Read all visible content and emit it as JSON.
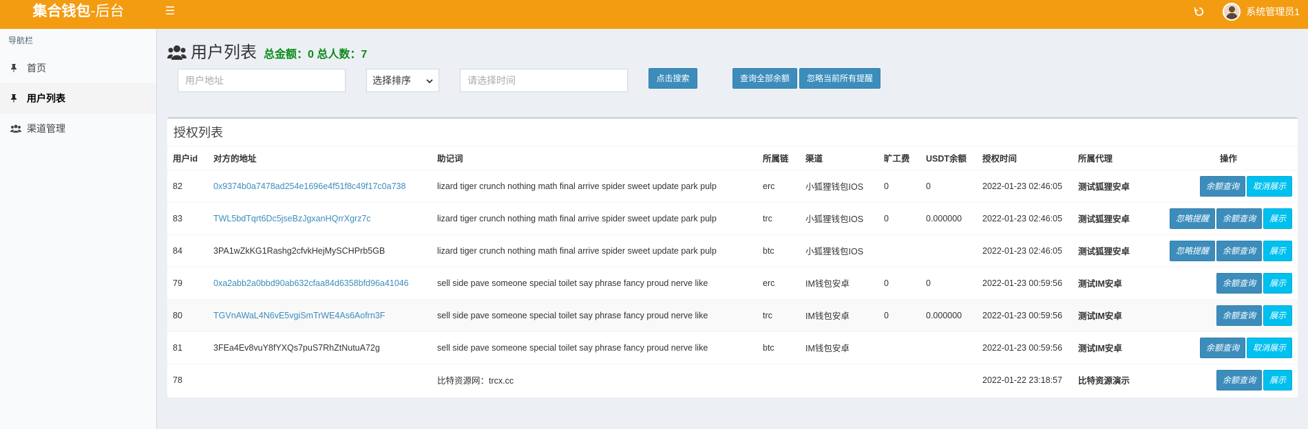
{
  "header": {
    "logo_bold": "集合钱包",
    "logo_rest": "-后台",
    "user_name": "系统管理员1",
    "menu_icon": "hamburger-icon",
    "refresh_icon": "refresh-icon"
  },
  "sidebar": {
    "heading": "导航栏",
    "items": [
      {
        "label": "首页",
        "icon": "pin-icon"
      },
      {
        "label": "用户列表",
        "icon": "pin-icon"
      },
      {
        "label": "渠道管理",
        "icon": "users-icon"
      }
    ]
  },
  "page": {
    "title": "用户列表",
    "stats": "总金额：0 总人数：7"
  },
  "filters": {
    "address_placeholder": "用户地址",
    "sort_value": "选择排序",
    "time_placeholder": "请选择时间",
    "search_label": "点击搜索",
    "query_all_label": "查询全部余额",
    "ignore_all_label": "忽略当前所有提醒"
  },
  "panel": {
    "title": "授权列表",
    "columns": [
      "用户id",
      "对方的地址",
      "助记词",
      "所属链",
      "渠道",
      "旷工费",
      "USDT余额",
      "授权时间",
      "所属代理",
      "操作"
    ],
    "rows": [
      {
        "id": "82",
        "address": "0x9374b0a7478ad254e1696e4f51f8c49f17c0a738",
        "address_link": true,
        "mnemonic": "lizard tiger crunch nothing math final arrive spider sweet update park pulp",
        "chain": "erc",
        "channel": "小狐狸钱包IOS",
        "fee": "0",
        "usdt": "0",
        "time": "2022-01-23 02:46:05",
        "agent": "测试狐狸安卓",
        "actions": [
          {
            "label": "余额查询",
            "style": "blue"
          },
          {
            "label": "取消展示",
            "style": "cyan"
          }
        ]
      },
      {
        "id": "83",
        "address": "TWL5bdTqrt6Dc5jseBzJgxanHQrrXgrz7c",
        "address_link": true,
        "mnemonic": "lizard tiger crunch nothing math final arrive spider sweet update park pulp",
        "chain": "trc",
        "channel": "小狐狸钱包IOS",
        "fee": "0",
        "usdt": "0.000000",
        "time": "2022-01-23 02:46:05",
        "agent": "测试狐狸安卓",
        "actions": [
          {
            "label": "忽略提醒",
            "style": "blue"
          },
          {
            "label": "余额查询",
            "style": "blue"
          },
          {
            "label": "展示",
            "style": "cyan"
          }
        ]
      },
      {
        "id": "84",
        "address": "3PA1wZkKG1Rashg2cfvkHejMySCHPrb5GB",
        "address_link": false,
        "mnemonic": "lizard tiger crunch nothing math final arrive spider sweet update park pulp",
        "chain": "btc",
        "channel": "小狐狸钱包IOS",
        "fee": "",
        "usdt": "",
        "time": "2022-01-23 02:46:05",
        "agent": "测试狐狸安卓",
        "actions": [
          {
            "label": "忽略提醒",
            "style": "blue"
          },
          {
            "label": "余额查询",
            "style": "blue"
          },
          {
            "label": "展示",
            "style": "cyan"
          }
        ]
      },
      {
        "id": "79",
        "address": "0xa2abb2a0bbd90ab632cfaa84d6358bfd96a41046",
        "address_link": true,
        "mnemonic": "sell side pave someone special toilet say phrase fancy proud nerve like",
        "chain": "erc",
        "channel": "IM钱包安卓",
        "fee": "0",
        "usdt": "0",
        "time": "2022-01-23 00:59:56",
        "agent": "测试IM安卓",
        "actions": [
          {
            "label": "余额查询",
            "style": "blue"
          },
          {
            "label": "展示",
            "style": "cyan"
          }
        ]
      },
      {
        "id": "80",
        "address": "TGVnAWaL4N6vE5vgiSmTrWE4As6Aofrn3F",
        "address_link": true,
        "mnemonic": "sell side pave someone special toilet say phrase fancy proud nerve like",
        "chain": "trc",
        "channel": "IM钱包安卓",
        "fee": "0",
        "usdt": "0.000000",
        "time": "2022-01-23 00:59:56",
        "agent": "测试IM安卓",
        "actions": [
          {
            "label": "余额查询",
            "style": "blue"
          },
          {
            "label": "展示",
            "style": "cyan"
          }
        ]
      },
      {
        "id": "81",
        "address": "3FEa4Ev8vuY8fYXQs7puS7RhZtNutuA72g",
        "address_link": false,
        "mnemonic": "sell side pave someone special toilet say phrase fancy proud nerve like",
        "chain": "btc",
        "channel": "IM钱包安卓",
        "fee": "",
        "usdt": "",
        "time": "2022-01-23 00:59:56",
        "agent": "测试IM安卓",
        "actions": [
          {
            "label": "余额查询",
            "style": "blue"
          },
          {
            "label": "取消展示",
            "style": "cyan"
          }
        ]
      },
      {
        "id": "78",
        "address": "",
        "address_link": false,
        "mnemonic": "比特资源网：trcx.cc",
        "chain": "",
        "channel": "",
        "fee": "",
        "usdt": "",
        "time": "2022-01-22 23:18:57",
        "agent": "比特资源演示",
        "actions": [
          {
            "label": "余额查询",
            "style": "blue"
          },
          {
            "label": "展示",
            "style": "cyan"
          }
        ]
      }
    ]
  }
}
